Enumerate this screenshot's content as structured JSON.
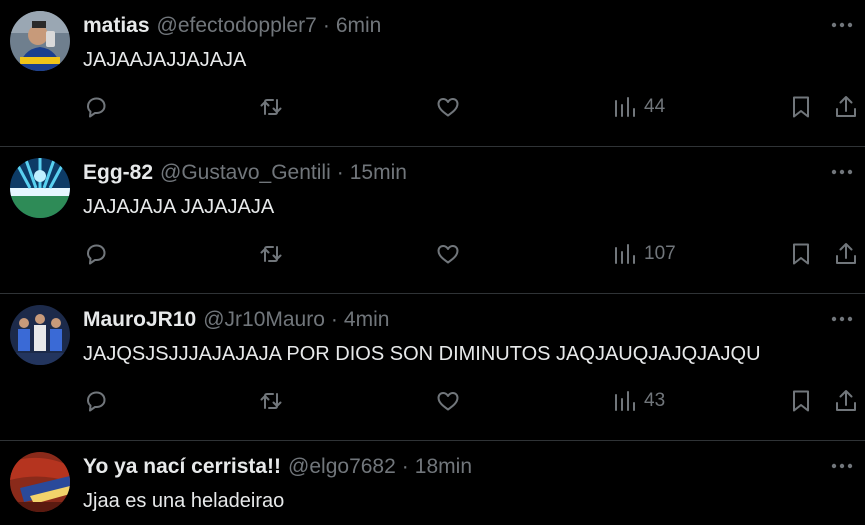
{
  "tweets": [
    {
      "name": "matias",
      "handle": "@efectodoppler7",
      "time": "6min",
      "text": "JAJAAJAJJAJAJA",
      "views": "44",
      "avatar_icon": "avatar-photo-person",
      "avatar_colors": [
        "#7a8a99",
        "#f0c419",
        "#1b3f8f"
      ]
    },
    {
      "name": "Egg-82",
      "handle": "@Gustavo_Gentili",
      "time": "15min",
      "text": "JAJAJAJA JAJAJAJA",
      "views": "107",
      "avatar_icon": "avatar-photo-stadium-lights",
      "avatar_colors": [
        "#0d3b66",
        "#5ad1f0",
        "#2e8b57"
      ]
    },
    {
      "name": "MauroJR10",
      "handle": "@Jr10Mauro",
      "time": "4min",
      "text": "JAJQSJSJJJAJAJAJA POR DIOS SON DIMINUTOS JAQJAUQJAJQJAJQU",
      "views": "43",
      "avatar_icon": "avatar-photo-football-players",
      "avatar_colors": [
        "#1c2a4a",
        "#3a6ad6",
        "#e8e8e8"
      ]
    },
    {
      "name": "Yo ya nací cerrista!!",
      "handle": "@elgo7682",
      "time": "18min",
      "text": "Jjaa es una heladeirao",
      "views": "",
      "avatar_icon": "avatar-photo-stadium-crowd",
      "avatar_colors": [
        "#b5341f",
        "#2a4a9a",
        "#f2d36b"
      ]
    }
  ],
  "separator": "·",
  "icons": {
    "more": "more-dots-icon",
    "reply": "reply-icon",
    "retweet": "retweet-icon",
    "like": "heart-icon",
    "views": "views-bars-icon",
    "bookmark": "bookmark-icon",
    "share": "share-icon"
  },
  "colors": {
    "background": "#000000",
    "text": "#e7e9ea",
    "muted": "#71767b",
    "divider": "#2f3336"
  }
}
